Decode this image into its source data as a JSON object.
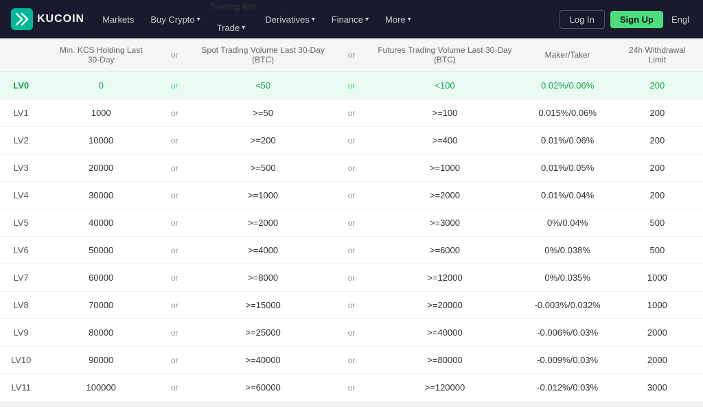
{
  "navbar": {
    "logo_text": "KUCOIN",
    "nav_items": [
      {
        "label": "Markets",
        "has_dropdown": false,
        "highlight": false
      },
      {
        "label": "Buy Crypto",
        "has_dropdown": true,
        "highlight": false
      },
      {
        "label": "Trade",
        "has_dropdown": true,
        "highlight": false,
        "badge": "Trading Bot"
      },
      {
        "label": "Derivatives",
        "has_dropdown": true,
        "highlight": false
      },
      {
        "label": "Finance",
        "has_dropdown": true,
        "highlight": false
      },
      {
        "label": "More",
        "has_dropdown": true,
        "highlight": false
      }
    ],
    "login_label": "Log In",
    "signup_label": "Sign Up",
    "lang_label": "Engl"
  },
  "table": {
    "headers": [
      "Min. KCS Holding Last 30-Day",
      "or",
      "Spot Trading Volume Last 30-Day (BTC)",
      "or",
      "Futures Trading Volume Last 30-Day (BTC)",
      "Maker/Taker",
      "24h Withdrawal Limit"
    ],
    "rows": [
      {
        "level": "LV0",
        "kcs": "0",
        "spot": "<50",
        "futures": "<100",
        "fee": "0.02%/0.06%",
        "withdrawal": "200"
      },
      {
        "level": "LV1",
        "kcs": "1000",
        "spot": ">=50",
        "futures": ">=100",
        "fee": "0.015%/0.06%",
        "withdrawal": "200"
      },
      {
        "level": "LV2",
        "kcs": "10000",
        "spot": ">=200",
        "futures": ">=400",
        "fee": "0.01%/0.06%",
        "withdrawal": "200"
      },
      {
        "level": "LV3",
        "kcs": "20000",
        "spot": ">=500",
        "futures": ">=1000",
        "fee": "0.01%/0.05%",
        "withdrawal": "200"
      },
      {
        "level": "LV4",
        "kcs": "30000",
        "spot": ">=1000",
        "futures": ">=2000",
        "fee": "0.01%/0.04%",
        "withdrawal": "200"
      },
      {
        "level": "LV5",
        "kcs": "40000",
        "spot": ">=2000",
        "futures": ">=3000",
        "fee": "0%/0.04%",
        "withdrawal": "500"
      },
      {
        "level": "LV6",
        "kcs": "50000",
        "spot": ">=4000",
        "futures": ">=6000",
        "fee": "0%/0.038%",
        "withdrawal": "500"
      },
      {
        "level": "LV7",
        "kcs": "60000",
        "spot": ">=8000",
        "futures": ">=12000",
        "fee": "0%/0.035%",
        "withdrawal": "1000"
      },
      {
        "level": "LV8",
        "kcs": "70000",
        "spot": ">=15000",
        "futures": ">=20000",
        "fee": "-0.003%/0.032%",
        "withdrawal": "1000"
      },
      {
        "level": "LV9",
        "kcs": "80000",
        "spot": ">=25000",
        "futures": ">=40000",
        "fee": "-0.006%/0.03%",
        "withdrawal": "2000"
      },
      {
        "level": "LV10",
        "kcs": "90000",
        "spot": ">=40000",
        "futures": ">=80000",
        "fee": "-0.009%/0.03%",
        "withdrawal": "2000"
      },
      {
        "level": "LV11",
        "kcs": "100000",
        "spot": ">=60000",
        "futures": ">=120000",
        "fee": "-0.012%/0.03%",
        "withdrawal": "3000"
      }
    ]
  }
}
